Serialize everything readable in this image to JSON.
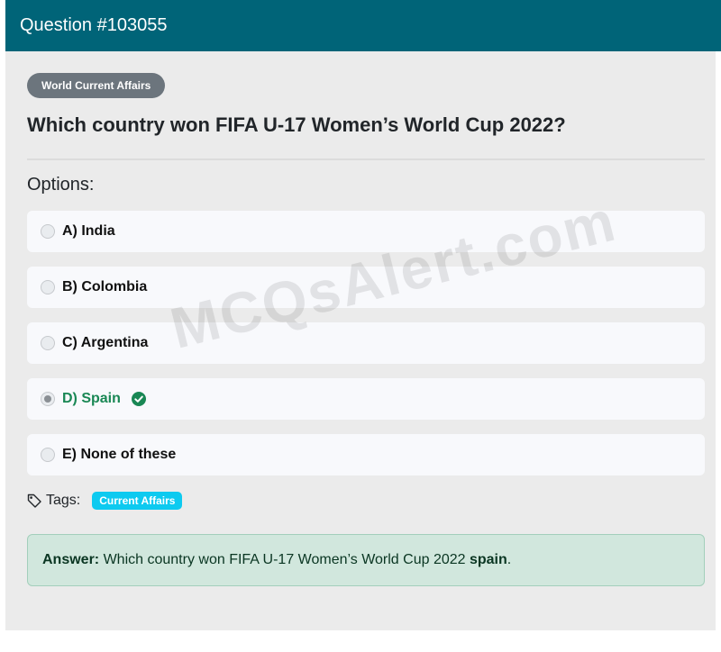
{
  "header": {
    "title": "Question #103055"
  },
  "category": {
    "label": "World Current Affairs"
  },
  "question": {
    "text": "Which country won FIFA U-17 Women’s World Cup 2022?"
  },
  "options_heading": "Options:",
  "options": [
    {
      "label": "A) India",
      "selected": false,
      "correct": false
    },
    {
      "label": "B) Colombia",
      "selected": false,
      "correct": false
    },
    {
      "label": "C) Argentina",
      "selected": false,
      "correct": false
    },
    {
      "label": "D) Spain",
      "selected": true,
      "correct": true
    },
    {
      "label": "E) None of these",
      "selected": false,
      "correct": false
    }
  ],
  "tags": {
    "label": "Tags:",
    "items": [
      "Current Affairs"
    ]
  },
  "answer": {
    "prefix": "Answer:",
    "text": "Which country won FIFA U-17 Women’s World Cup 2022",
    "value": "spain",
    "suffix": "."
  },
  "watermark": "MCQsAlert.com",
  "colors": {
    "header_bg": "#006478",
    "correct": "#198754",
    "tag_badge": "#0dcaf0",
    "answer_bg": "#d1e7dd"
  },
  "icons": {
    "correct": "check-circle-icon",
    "tags": "tag-icon"
  }
}
